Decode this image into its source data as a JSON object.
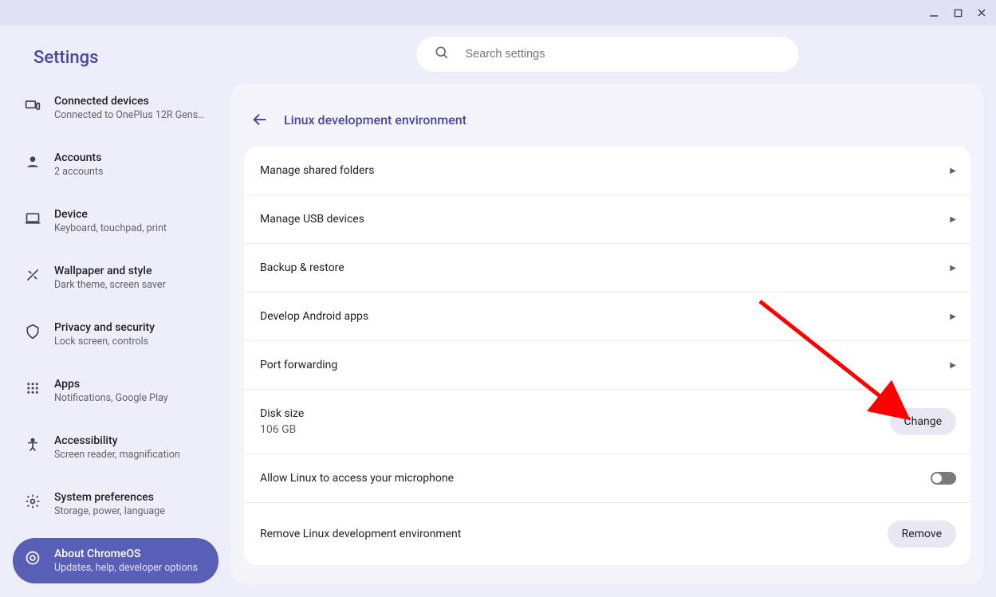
{
  "app_title": "Settings",
  "search": {
    "placeholder": "Search settings"
  },
  "sidebar": {
    "items": [
      {
        "title": "Connected devices",
        "sub": "Connected to OnePlus 12R Gens…"
      },
      {
        "title": "Accounts",
        "sub": "2 accounts"
      },
      {
        "title": "Device",
        "sub": "Keyboard, touchpad, print"
      },
      {
        "title": "Wallpaper and style",
        "sub": "Dark theme, screen saver"
      },
      {
        "title": "Privacy and security",
        "sub": "Lock screen, controls"
      },
      {
        "title": "Apps",
        "sub": "Notifications, Google Play"
      },
      {
        "title": "Accessibility",
        "sub": "Screen reader, magnification"
      },
      {
        "title": "System preferences",
        "sub": "Storage, power, language"
      },
      {
        "title": "About ChromeOS",
        "sub": "Updates, help, developer options"
      }
    ]
  },
  "page": {
    "title": "Linux development environment",
    "rows": {
      "shared_folders": "Manage shared folders",
      "usb": "Manage USB devices",
      "backup": "Backup & restore",
      "android": "Develop Android apps",
      "port": "Port forwarding",
      "disk_label": "Disk size",
      "disk_value": "106 GB",
      "disk_button": "Change",
      "mic": "Allow Linux to access your microphone",
      "remove_label": "Remove Linux development environment",
      "remove_button": "Remove"
    }
  }
}
